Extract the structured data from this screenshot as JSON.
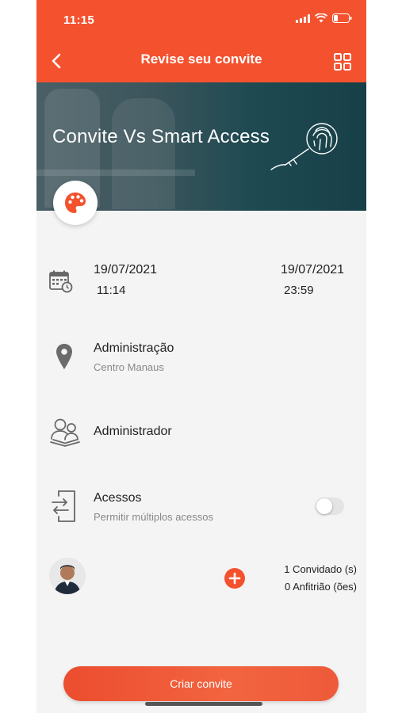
{
  "status_bar": {
    "time": "11:15"
  },
  "nav": {
    "title": "Revise seu convite",
    "back_icon": "chevron-left-icon",
    "menu_icon": "grid-icon"
  },
  "banner": {
    "title": "Convite Vs Smart Access",
    "icon": "fingerprint-key-icon"
  },
  "palette_icon": "palette-icon",
  "schedule": {
    "start_date": "19/07/2021",
    "start_time": "11:14",
    "end_date": "19/07/2021",
    "end_time": "23:59",
    "icon": "calendar-clock-icon"
  },
  "location": {
    "name": "Administração",
    "subtitle": "Centro Manaus",
    "icon": "location-pin-icon"
  },
  "role": {
    "name": "Administrador",
    "icon": "group-icon"
  },
  "access": {
    "title": "Acessos",
    "subtitle": "Permitir múltiplos acessos",
    "multiple_enabled": false,
    "icon": "door-exchange-icon"
  },
  "guests": {
    "invited": "1 Convidado (s)",
    "hosts": "0 Anfitrião (ões)"
  },
  "cta": {
    "label": "Criar convite"
  },
  "colors": {
    "accent": "#f4522f",
    "banner": "#1f4a52",
    "background": "#f4f4f4"
  }
}
